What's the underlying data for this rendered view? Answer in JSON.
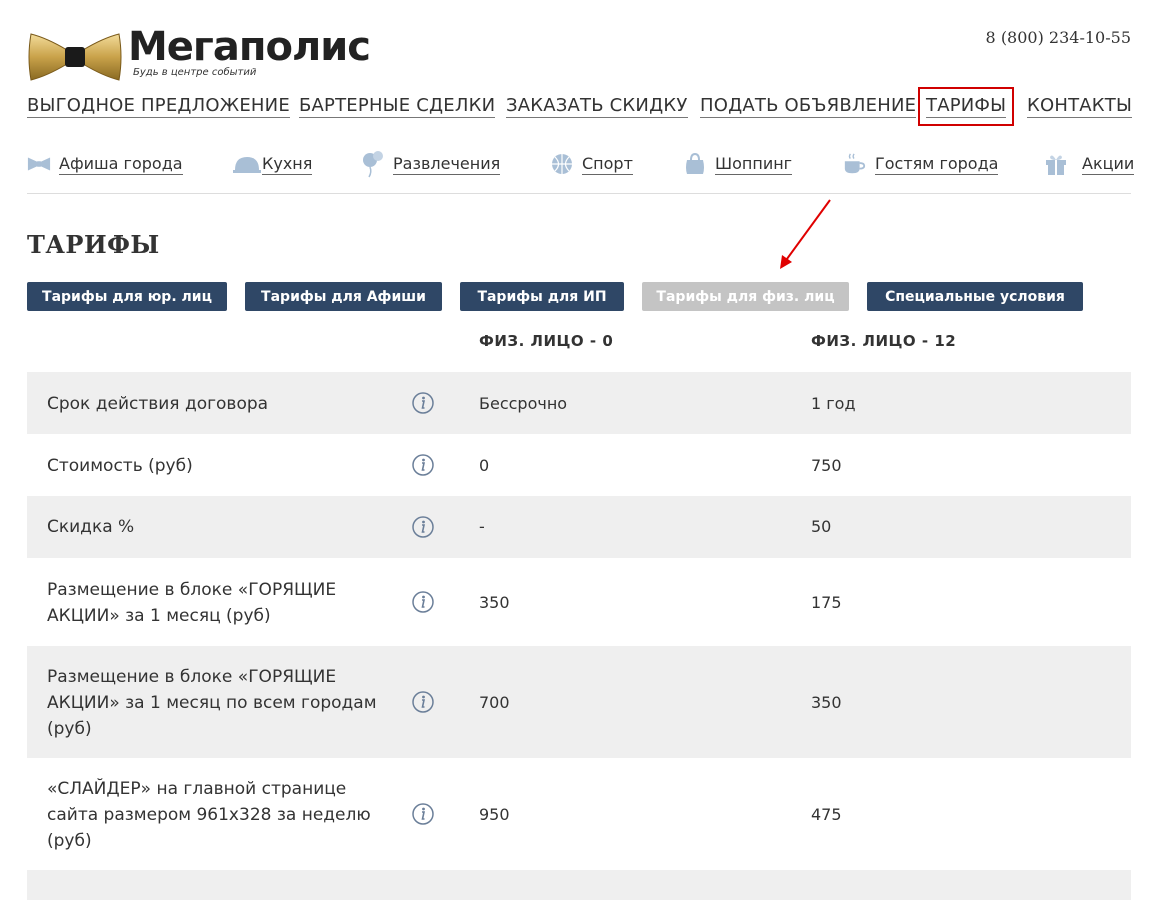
{
  "brand": {
    "name": "Мегаполис",
    "tagline": "Будь в центре событий",
    "phone": "8 (800) 234-10-55",
    "logo_icon": "bow-tie-icon"
  },
  "topnav": {
    "items": [
      {
        "label": "ВЫГОДНОЕ ПРЕДЛОЖЕНИЕ"
      },
      {
        "label": "БАРТЕРНЫЕ СДЕЛКИ"
      },
      {
        "label": "ЗАКАЗАТЬ СКИДКУ"
      },
      {
        "label": "ПОДАТЬ ОБЪЯВЛЕНИЕ"
      },
      {
        "label": "ТАРИФЫ"
      },
      {
        "label": "КОНТАКТЫ"
      }
    ],
    "highlight_color": "#d00000"
  },
  "subnav": {
    "items": [
      {
        "label": "Афиша города",
        "icon": "bow-tie-icon"
      },
      {
        "label": "Кухня",
        "icon": "cloche-icon"
      },
      {
        "label": "Развлечения",
        "icon": "balloons-icon"
      },
      {
        "label": "Спорт",
        "icon": "basketball-icon"
      },
      {
        "label": "Шоппинг",
        "icon": "shopping-bag-icon"
      },
      {
        "label": "Гостям города",
        "icon": "coffee-cup-icon"
      },
      {
        "label": "Акции",
        "icon": "gift-icon"
      }
    ],
    "icon_color": "#a9bfd6"
  },
  "page": {
    "title": "ТАРИФЫ"
  },
  "tabs": [
    {
      "label": "Тарифы для юр. лиц"
    },
    {
      "label": "Тарифы для Афиши"
    },
    {
      "label": "Тарифы для ИП"
    },
    {
      "label": "Тарифы для физ. лиц"
    },
    {
      "label": "Специальные условия"
    }
  ],
  "colors": {
    "tab_active": "#2f4766",
    "tab_current": "#c4c4c4",
    "row_shade": "#efefef"
  },
  "table": {
    "columns": [
      "ФИЗ. ЛИЦО - 0",
      "ФИЗ. ЛИЦО - 12"
    ],
    "rows": [
      {
        "label": "Срок действия договора",
        "v0": "Бессрочно",
        "v12": "1 год"
      },
      {
        "label": "Стоимость (руб)",
        "v0": "0",
        "v12": "750"
      },
      {
        "label": "Скидка %",
        "v0": "-",
        "v12": "50"
      },
      {
        "label": "Размещение в блоке «ГОРЯЩИЕ АКЦИИ» за 1 месяц (руб)",
        "v0": "350",
        "v12": "175"
      },
      {
        "label": "Размещение в блоке «ГОРЯЩИЕ АКЦИИ» за 1 месяц по всем городам (руб)",
        "v0": "700",
        "v12": "350"
      },
      {
        "label": "«СЛАЙДЕР» на главной странице сайта размером 961x328 за неделю (руб)",
        "v0": "950",
        "v12": "475"
      }
    ]
  }
}
